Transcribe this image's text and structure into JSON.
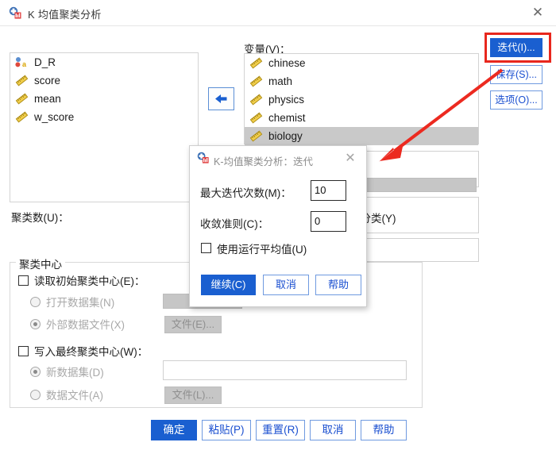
{
  "window": {
    "title": "K 均值聚类分析",
    "icon": "spss-app-icon",
    "close_label": "✕"
  },
  "source_list": {
    "items": [
      {
        "name": "D_R",
        "measure": "nominal"
      },
      {
        "name": "score",
        "measure": "scale"
      },
      {
        "name": "mean",
        "measure": "scale"
      },
      {
        "name": "w_score",
        "measure": "scale"
      }
    ]
  },
  "move_button": {
    "icon": "arrow-left-icon"
  },
  "variables": {
    "label": "变量(V)：",
    "items": [
      {
        "name": "chinese",
        "measure": "scale",
        "selected": false
      },
      {
        "name": "math",
        "measure": "scale",
        "selected": false
      },
      {
        "name": "physics",
        "measure": "scale",
        "selected": false
      },
      {
        "name": "chemist",
        "measure": "scale",
        "selected": false
      },
      {
        "name": "biology",
        "measure": "scale",
        "selected": true
      }
    ]
  },
  "case_label": {
    "value": ""
  },
  "side_buttons": [
    {
      "label": "迭代(I)...",
      "name": "iterate",
      "primary": true,
      "highlighted": true
    },
    {
      "label": "保存(S)...",
      "name": "save",
      "primary": false,
      "highlighted": false
    },
    {
      "label": "选项(O)...",
      "name": "options",
      "primary": false,
      "highlighted": false
    }
  ],
  "cluster_count": {
    "label": "聚类数(U)：",
    "value": ""
  },
  "method": {
    "option_label": "仅分类(Y)"
  },
  "cluster_centers": {
    "group_title": "聚类中心",
    "read_initial": {
      "label": "读取初始聚类中心(E)：",
      "checked": false,
      "options": [
        {
          "label": "打开数据集(N)",
          "selected": false
        },
        {
          "label": "外部数据文件(X)",
          "selected": true
        }
      ],
      "file_button": "文件(E)..."
    },
    "write_final": {
      "label": "写入最终聚类中心(W)：",
      "checked": false,
      "options": [
        {
          "label": "新数据集(D)",
          "selected": true
        },
        {
          "label": "数据文件(A)",
          "selected": false
        }
      ],
      "dataset_value": "",
      "file_button": "文件(L)..."
    }
  },
  "footer_buttons": [
    {
      "label": "确定",
      "name": "ok",
      "primary": true
    },
    {
      "label": "粘贴(P)",
      "name": "paste",
      "primary": false
    },
    {
      "label": "重置(R)",
      "name": "reset",
      "primary": false
    },
    {
      "label": "取消",
      "name": "cancel",
      "primary": false
    },
    {
      "label": "帮助",
      "name": "help",
      "primary": false
    }
  ],
  "iterate_dialog": {
    "title": "K-均值聚类分析：迭代",
    "icon": "spss-app-icon",
    "close_label": "✕",
    "max_iterations": {
      "label": "最大迭代次数(M)：",
      "value": "10"
    },
    "convergence": {
      "label": "收敛准则(C)：",
      "value": "0"
    },
    "running_means": {
      "label": "使用运行平均值(U)",
      "checked": false
    },
    "buttons": [
      {
        "label": "继续(C)",
        "name": "continue",
        "primary": true
      },
      {
        "label": "取消",
        "name": "cancel",
        "primary": false
      },
      {
        "label": "帮助",
        "name": "help",
        "primary": false
      }
    ]
  },
  "annotation": {
    "arrow_color": "#ec2a20",
    "box_color": "#e8271d"
  }
}
